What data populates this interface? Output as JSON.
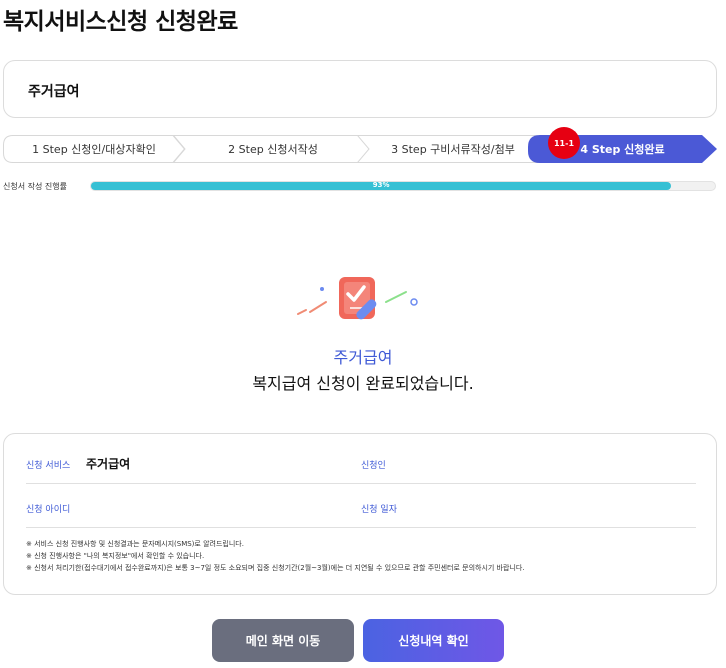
{
  "page": {
    "title": "복지서비스신청 신청완료"
  },
  "service": {
    "name": "주거급여"
  },
  "steps": [
    {
      "label": "1 Step 신청인/대상자확인",
      "active": false
    },
    {
      "label": "2 Step 신청서작성",
      "active": false
    },
    {
      "label": "3 Step 구비서류작성/첨부",
      "active": false
    },
    {
      "label": "4 Step 신청완료",
      "active": true
    }
  ],
  "badge": {
    "text": "11-1"
  },
  "progress": {
    "label": "신청서 작성 진행률",
    "percent_text": "93%",
    "value": 0.93
  },
  "completion": {
    "service": "주거급여",
    "message": "복지급여 신청이 완료되었습니다."
  },
  "info": {
    "service_label": "신청 서비스",
    "service_value": "주거급여",
    "applicant_label": "신청인",
    "applicant_value": "",
    "id_label": "신청 아이디",
    "id_value": "",
    "date_label": "신청 일자",
    "date_value": ""
  },
  "notes": [
    "※ 서비스 신청 진행사항 및 신청결과는 문자메시지(SMS)로 알려드립니다.",
    "※ 신청 진행사항은 \"나의 복지정보\"에서 확인할 수 있습니다.",
    "※ 신청서 처리기한(접수대기에서 접수완료까지)은 보통 3~7일 정도 소요되며 집중 신청기간(2월~3월)에는 더 지연될 수 있으므로 관할 주민센터로 문의하시기 바랍니다."
  ],
  "buttons": {
    "main": "메인 화면 이동",
    "confirm": "신청내역 확인"
  },
  "colors": {
    "accent": "#3f5ad6",
    "progress": "#36c0d4",
    "badge": "#e60012",
    "button_gray": "#6a6e7e"
  }
}
